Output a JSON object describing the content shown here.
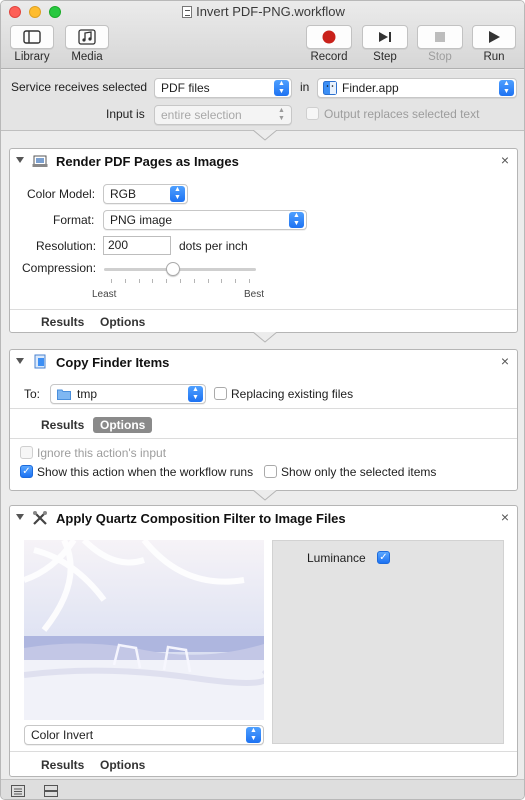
{
  "window": {
    "title": "Invert PDF-PNG.workflow"
  },
  "toolbar": {
    "library": "Library",
    "media": "Media",
    "record": "Record",
    "step": "Step",
    "stop": "Stop",
    "run": "Run"
  },
  "service": {
    "receives_label": "Service receives selected",
    "receives_value": "PDF files",
    "in_label": "in",
    "app_value": "Finder.app",
    "input_label": "Input is",
    "input_value": "entire selection",
    "output_replaces": "Output replaces selected text",
    "output_replaces_checked": false
  },
  "action1": {
    "title": "Render PDF Pages as Images",
    "color_model_label": "Color Model:",
    "color_model_value": "RGB",
    "format_label": "Format:",
    "format_value": "PNG image",
    "resolution_label": "Resolution:",
    "resolution_value": "200",
    "resolution_unit": "dots per inch",
    "compression_label": "Compression:",
    "compression_level": 0.45,
    "least": "Least",
    "best": "Best",
    "results": "Results",
    "options": "Options"
  },
  "action2": {
    "title": "Copy Finder Items",
    "to_label": "To:",
    "to_value": "tmp",
    "replacing": "Replacing existing files",
    "replacing_checked": false,
    "results": "Results",
    "options": "Options",
    "ignore_input": "Ignore this action's input",
    "ignore_input_checked": false,
    "show_when_runs": "Show this action when the workflow runs",
    "show_when_runs_checked": true,
    "show_only_selected": "Show only the selected items",
    "show_only_selected_checked": false
  },
  "action3": {
    "title": "Apply Quartz Composition Filter to Image Files",
    "filter_value": "Color Invert",
    "luminance_label": "Luminance",
    "luminance_checked": true,
    "results": "Results",
    "options": "Options"
  },
  "colors": {
    "accent": "#1d72f2",
    "record_red": "#c9211a",
    "panel_bg": "#ffffff",
    "window_bg": "#ececec"
  }
}
